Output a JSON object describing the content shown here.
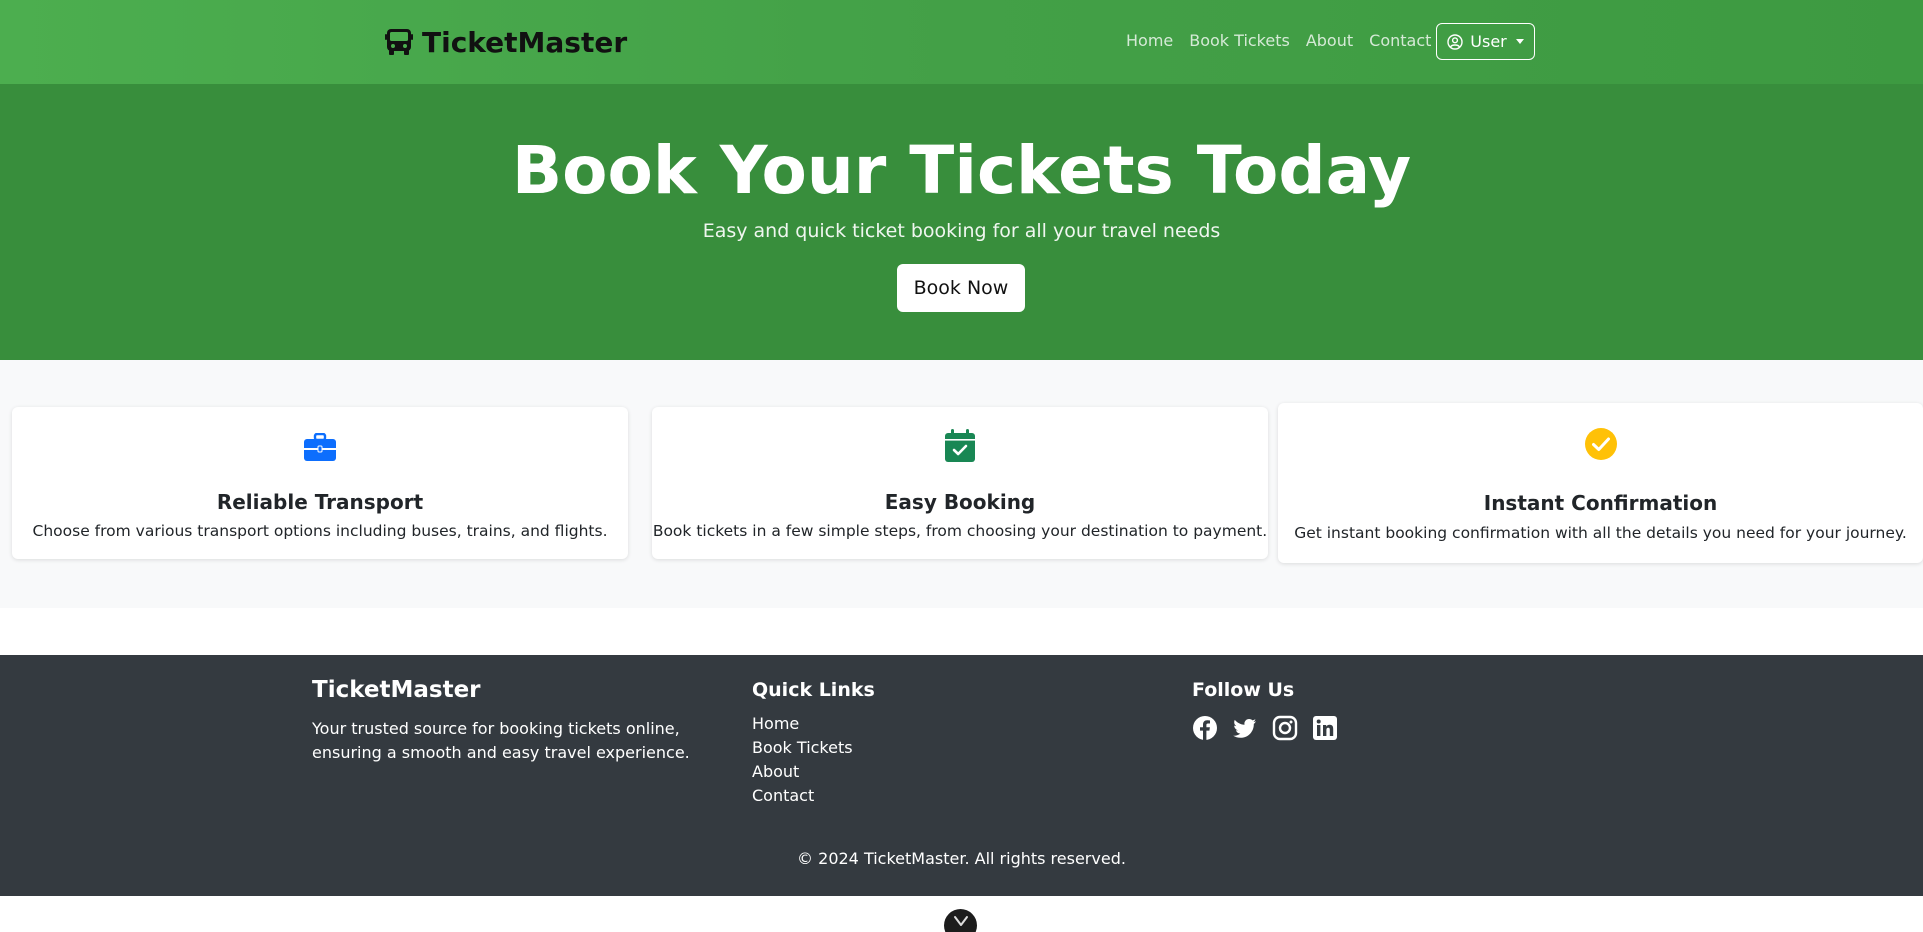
{
  "navbar": {
    "brand": "TicketMaster",
    "links": [
      "Home",
      "Book Tickets",
      "About",
      "Contact"
    ],
    "user_label": "User"
  },
  "hero": {
    "title": "Book Your Tickets Today",
    "subtitle": "Easy and quick ticket booking for all your travel needs",
    "cta_label": "Book Now",
    "background": "#388e3c"
  },
  "features": [
    {
      "icon": "briefcase-icon",
      "title": "Reliable Transport",
      "text": "Choose from various transport options including buses, trains, and flights.",
      "color": "#0d6efd"
    },
    {
      "icon": "calendar-check-icon",
      "title": "Easy Booking",
      "text": "Book tickets in a few simple steps, from choosing your destination to payment.",
      "color": "#198754"
    },
    {
      "icon": "check-circle-icon",
      "title": "Instant Confirmation",
      "text": "Get instant booking confirmation with all the details you need for your journey.",
      "color": "#ffc107"
    }
  ],
  "footer": {
    "brand": "TicketMaster",
    "description": "Your trusted source for booking tickets online, ensuring a smooth and easy travel experience.",
    "quick_links_title": "Quick Links",
    "quick_links": [
      "Home",
      "Book Tickets",
      "About",
      "Contact"
    ],
    "follow_title": "Follow Us",
    "socials": [
      "facebook-icon",
      "twitter-icon",
      "instagram-icon",
      "linkedin-icon"
    ],
    "copyright": "© 2024 TicketMaster. All rights reserved.",
    "background": "#343a40"
  }
}
